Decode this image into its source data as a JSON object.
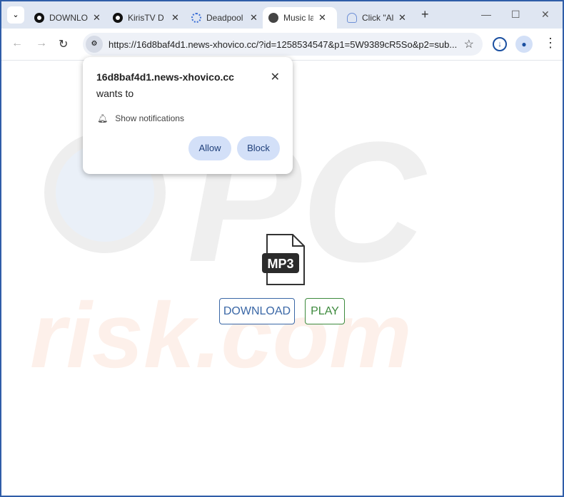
{
  "tabs": [
    {
      "title": "DOWNLOAD",
      "icon": "youtube-like-icon"
    },
    {
      "title": "KirisTV D",
      "icon": "youtube-like-icon"
    },
    {
      "title": "Deadpool",
      "icon": "loading-spinner-icon"
    },
    {
      "title": "Music lab",
      "icon": "globe-icon",
      "active": true
    },
    {
      "title": "Click \"Allow\"",
      "icon": "notification-bell-icon"
    }
  ],
  "address_bar": {
    "url": "https://16d8baf4d1.news-xhovico.cc/?id=1258534547&p1=5W9389cR5So&p2=sub..."
  },
  "popup": {
    "site": "16d8baf4d1.news-xhovico.cc",
    "wants_to": "wants to",
    "permission": "Show notifications",
    "allow": "Allow",
    "block": "Block"
  },
  "page": {
    "file_label": "MP3",
    "download": "DOWNLOAD",
    "play": "PLAY"
  },
  "watermark": {
    "text1": "PC",
    "text2": "risk.com"
  }
}
